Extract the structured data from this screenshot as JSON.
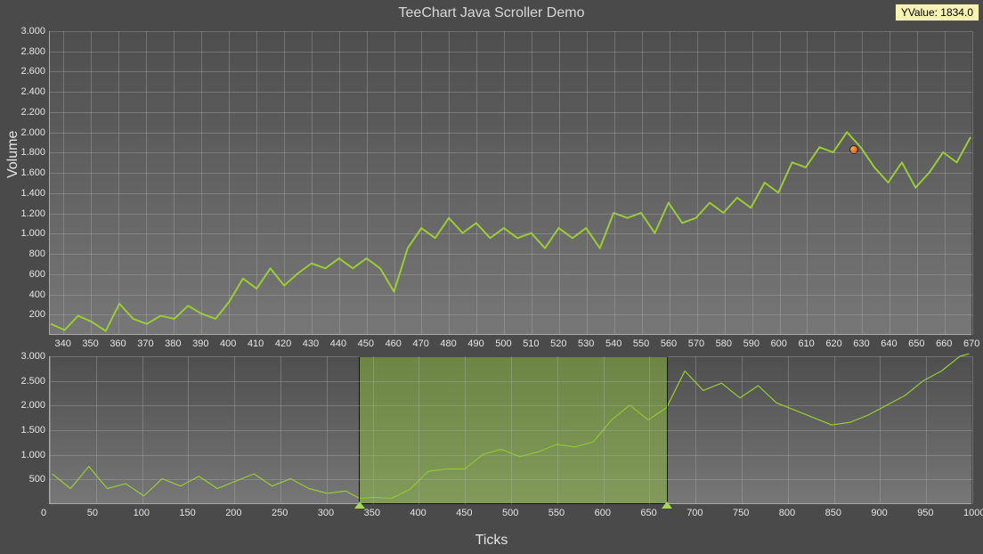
{
  "title": "TeeChart Java Scroller Demo",
  "tooltip_label": "YValue: 1834.0",
  "ylabel": "Volume",
  "xlabel": "Ticks",
  "chart_data": [
    {
      "type": "line",
      "name": "main",
      "title": "TeeChart Java Scroller Demo",
      "xlabel": "Ticks",
      "ylabel": "Volume",
      "x_range": [
        335,
        670
      ],
      "y_range": [
        0,
        3000
      ],
      "x_tick_step": 10,
      "y_ticks": [
        200,
        400,
        600,
        800,
        1000,
        1200,
        1400,
        1600,
        1800,
        2000,
        2200,
        2400,
        2600,
        2800,
        3000
      ],
      "y_tick_labels": [
        "200",
        "400",
        "600",
        "800",
        "1.000",
        "1.200",
        "1.400",
        "1.600",
        "1.800",
        "2.000",
        "2.200",
        "2.400",
        "2.600",
        "2.800",
        "3.000"
      ],
      "series": [
        {
          "name": "volume",
          "color": "#9acd32",
          "x": [
            335,
            340,
            345,
            350,
            355,
            360,
            365,
            370,
            375,
            380,
            385,
            390,
            395,
            400,
            405,
            410,
            415,
            420,
            425,
            430,
            435,
            440,
            445,
            450,
            455,
            460,
            465,
            470,
            475,
            480,
            485,
            490,
            495,
            500,
            505,
            510,
            515,
            520,
            525,
            530,
            535,
            540,
            545,
            550,
            555,
            560,
            565,
            570,
            575,
            580,
            585,
            590,
            595,
            600,
            605,
            610,
            615,
            620,
            625,
            630,
            635,
            640,
            645,
            650,
            655,
            660,
            665,
            670
          ],
          "y": [
            100,
            40,
            180,
            120,
            30,
            300,
            150,
            100,
            180,
            150,
            280,
            200,
            150,
            320,
            550,
            450,
            650,
            480,
            600,
            700,
            650,
            750,
            650,
            750,
            650,
            420,
            850,
            1050,
            950,
            1150,
            1000,
            1100,
            950,
            1050,
            950,
            1000,
            850,
            1050,
            950,
            1050,
            850,
            1200,
            1150,
            1200,
            1000,
            1300,
            1100,
            1150,
            1300,
            1200,
            1350,
            1250,
            1500,
            1400,
            1700,
            1650,
            1850,
            1800,
            2000,
            1850,
            1650,
            1500,
            1700,
            1450,
            1600,
            1800,
            1700,
            1950
          ]
        }
      ],
      "marker": {
        "x": 627,
        "y": 1834
      }
    },
    {
      "type": "line",
      "name": "overview",
      "xlabel": "Ticks",
      "ylabel": "",
      "x_range": [
        0,
        1000
      ],
      "y_range": [
        0,
        3000
      ],
      "x_tick_step": 50,
      "y_ticks": [
        500,
        1000,
        1500,
        2000,
        2500,
        3000
      ],
      "y_tick_labels": [
        "500",
        "1.000",
        "1.500",
        "2.000",
        "2.500",
        "3.000"
      ],
      "scroll_window": {
        "start": 335,
        "end": 670
      },
      "series": [
        {
          "name": "volume-full",
          "color": "#9acd32",
          "x": [
            0,
            20,
            40,
            60,
            80,
            100,
            120,
            140,
            160,
            180,
            200,
            220,
            240,
            260,
            280,
            300,
            320,
            335,
            350,
            370,
            390,
            410,
            430,
            450,
            470,
            490,
            510,
            530,
            550,
            570,
            590,
            610,
            630,
            650,
            670,
            690,
            710,
            730,
            750,
            770,
            790,
            810,
            830,
            850,
            870,
            890,
            910,
            930,
            950,
            970,
            990,
            1000
          ],
          "y": [
            600,
            300,
            750,
            300,
            400,
            150,
            500,
            350,
            550,
            300,
            450,
            600,
            350,
            500,
            300,
            200,
            250,
            100,
            120,
            100,
            280,
            650,
            700,
            700,
            1000,
            1100,
            950,
            1050,
            1200,
            1150,
            1250,
            1700,
            2000,
            1700,
            1950,
            2700,
            2300,
            2450,
            2150,
            2400,
            2050,
            1900,
            1750,
            1600,
            1650,
            1800,
            2000,
            2200,
            2500,
            2700,
            3000,
            3050
          ]
        }
      ]
    }
  ]
}
